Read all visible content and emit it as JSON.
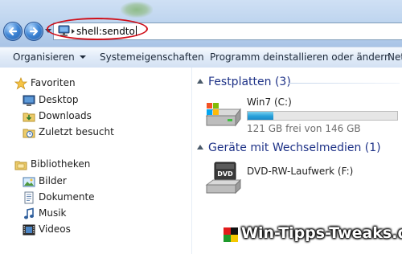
{
  "address_bar": {
    "path_text": "shell:sendto",
    "location_icon": "computer-icon"
  },
  "toolbar": {
    "organize_label": "Organisieren",
    "system_properties_label": "Systemeigenschaften",
    "uninstall_label": "Programm deinstallieren oder ändern",
    "network_label_partial": "Net"
  },
  "nav_pane": {
    "favorites_header": "Favoriten",
    "favorites": [
      {
        "label": "Desktop",
        "icon": "desktop-icon"
      },
      {
        "label": "Downloads",
        "icon": "downloads-folder-icon"
      },
      {
        "label": "Zuletzt besucht",
        "icon": "recent-places-icon"
      }
    ],
    "libraries_header": "Bibliotheken",
    "libraries": [
      {
        "label": "Bilder",
        "icon": "pictures-icon"
      },
      {
        "label": "Dokumente",
        "icon": "documents-icon"
      },
      {
        "label": "Musik",
        "icon": "music-icon"
      },
      {
        "label": "Videos",
        "icon": "videos-icon"
      }
    ]
  },
  "content": {
    "hard_drives_header": "Festplatten (3)",
    "drive_c": {
      "name": "Win7 (C:)",
      "free_text": "121 GB frei von 146 GB",
      "used_fraction": 0.17,
      "bar_color": "#26a0da"
    },
    "removable_header": "Geräte mit Wechselmedien (1)",
    "dvd_drive": {
      "name": "DVD-RW-Laufwerk (F:)",
      "icon_label": "DVD"
    }
  },
  "watermark": {
    "text": "Win-Tipps-Tweaks.de"
  },
  "colors": {
    "annotation_ellipse": "#d0101a",
    "group_header_text": "#1e3287"
  }
}
